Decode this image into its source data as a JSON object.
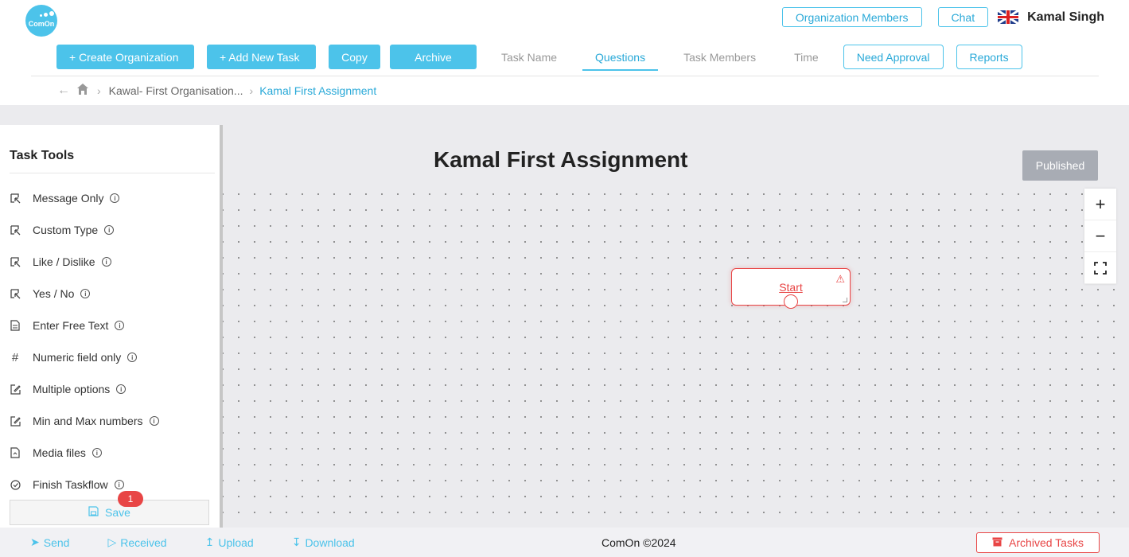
{
  "header": {
    "logo_text": "ComOn",
    "org_members_label": "Organization Members",
    "chat_label": "Chat",
    "username": "Kamal Singh"
  },
  "toolbar": {
    "create_org": "+ Create Organization",
    "add_task": "+ Add New Task",
    "copy": "Copy",
    "archive": "Archive",
    "tabs": [
      "Task Name",
      "Questions",
      "Task Members",
      "Time"
    ],
    "active_tab": "Questions",
    "need_approval": "Need Approval",
    "reports": "Reports"
  },
  "breadcrumb": {
    "org": "Kawal- First Organisation...",
    "current": "Kamal First Assignment"
  },
  "sidebar": {
    "title": "Task Tools",
    "items": [
      {
        "label": "Message Only",
        "icon": "select-icon"
      },
      {
        "label": "Custom Type",
        "icon": "select-icon"
      },
      {
        "label": "Like / Dislike",
        "icon": "select-icon"
      },
      {
        "label": "Yes / No",
        "icon": "select-icon"
      },
      {
        "label": "Enter Free Text",
        "icon": "document-icon"
      },
      {
        "label": "Numeric field only",
        "icon": "hash-icon"
      },
      {
        "label": "Multiple options",
        "icon": "edit-icon"
      },
      {
        "label": "Min and Max numbers",
        "icon": "edit-icon"
      },
      {
        "label": "Media files",
        "icon": "file-icon"
      },
      {
        "label": "Finish Taskflow",
        "icon": "check-circle-icon"
      }
    ],
    "save_label": "Save",
    "save_badge": "1"
  },
  "canvas": {
    "title": "Kamal First Assignment",
    "status": "Published",
    "start_node_label": "Start"
  },
  "footer": {
    "send": "Send",
    "received": "Received",
    "upload": "Upload",
    "download": "Download",
    "copyright": "ComOn ©2024",
    "archived": "Archived Tasks"
  },
  "colors": {
    "accent": "#4cc3ea",
    "danger": "#e84545",
    "published_bg": "#a8acb4"
  }
}
